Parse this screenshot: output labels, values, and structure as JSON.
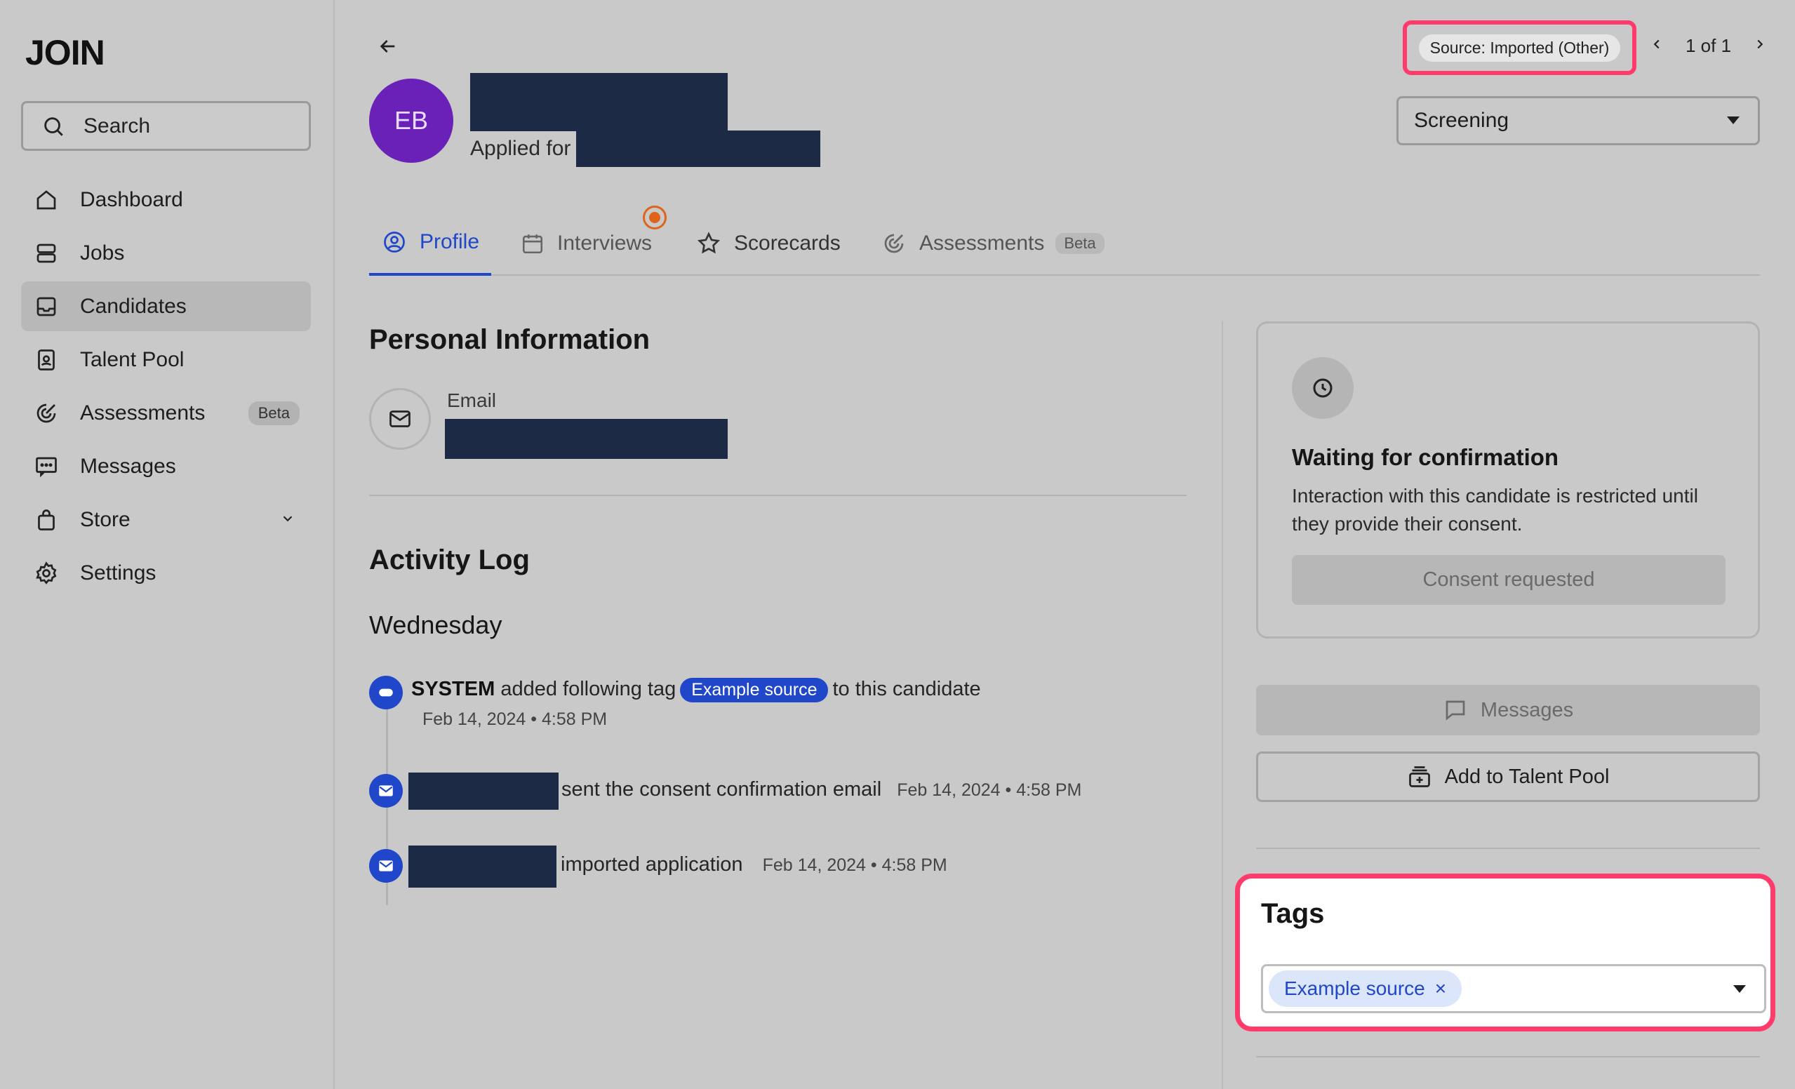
{
  "sidebar": {
    "logo": "JOIN",
    "search_label": "Search",
    "items": [
      {
        "label": "Dashboard",
        "icon": "home-icon"
      },
      {
        "label": "Jobs",
        "icon": "layers-icon"
      },
      {
        "label": "Candidates",
        "icon": "inbox-icon",
        "active": true
      },
      {
        "label": "Talent Pool",
        "icon": "contact-card-icon"
      },
      {
        "label": "Assessments",
        "icon": "target-icon",
        "badge": "Beta"
      },
      {
        "label": "Messages",
        "icon": "message-icon"
      },
      {
        "label": "Store",
        "icon": "bag-icon",
        "has_chevron": true
      },
      {
        "label": "Settings",
        "icon": "gear-icon"
      }
    ]
  },
  "header": {
    "avatar_initials": "EB",
    "applied_for_label": "Applied for",
    "source_label": "Source: Imported (Other)",
    "pager_text": "1 of 1",
    "stage_select": "Screening"
  },
  "tabs": [
    {
      "label": "Profile",
      "icon": "user-circle-icon",
      "active": true
    },
    {
      "label": "Interviews",
      "icon": "calendar-icon"
    },
    {
      "label": "Scorecards",
      "icon": "star-icon"
    },
    {
      "label": "Assessments",
      "icon": "target-icon",
      "badge": "Beta"
    }
  ],
  "personal": {
    "title": "Personal Information",
    "email_label": "Email"
  },
  "activity": {
    "title": "Activity Log",
    "day": "Wednesday",
    "entries": [
      {
        "actor": "SYSTEM",
        "text_before": "added following tag",
        "tag": "Example source",
        "text_after": "to this candidate",
        "time": "Feb 14, 2024 • 4:58 PM"
      },
      {
        "text": "sent the consent confirmation email",
        "time": "Feb 14, 2024 • 4:58 PM"
      },
      {
        "text": "imported application",
        "time": "Feb 14, 2024 • 4:58 PM"
      }
    ]
  },
  "consent": {
    "title": "Waiting for confirmation",
    "description": "Interaction with this candidate is restricted until they provide their consent.",
    "button": "Consent requested"
  },
  "actions": {
    "messages": "Messages",
    "add_to_pool": "Add to Talent Pool"
  },
  "tags": {
    "title": "Tags",
    "chips": [
      "Example source"
    ],
    "remove_glyph": "×"
  },
  "colors": {
    "accent": "#2047c9",
    "highlight": "#ff3b6b",
    "avatar": "#6a21b8",
    "redaction": "#1c2a45",
    "notification": "#e0631b"
  }
}
